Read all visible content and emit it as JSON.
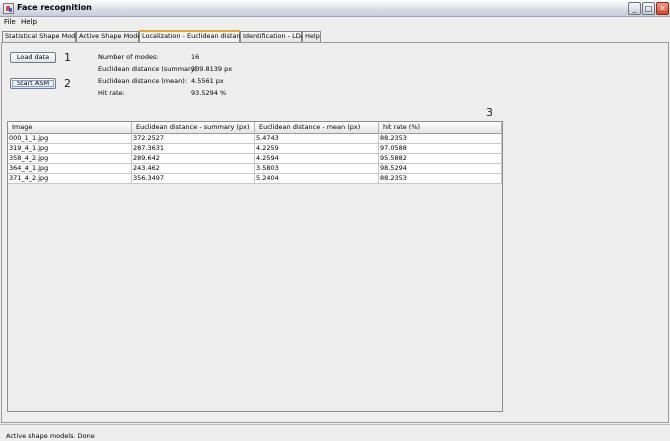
{
  "window": {
    "title": "Face recognition",
    "minimize_glyph": "_",
    "maximize_glyph": "□",
    "close_glyph": "✕"
  },
  "menu": {
    "items": [
      {
        "label": "File"
      },
      {
        "label": "Help"
      }
    ]
  },
  "tabs": [
    {
      "label": "Statistical Shape Model",
      "active": false
    },
    {
      "label": "Active Shape Model",
      "active": false
    },
    {
      "label": "Localization - Euclidean distance",
      "active": true
    },
    {
      "label": "Identification - LDA",
      "active": false
    },
    {
      "label": "Help",
      "active": false
    }
  ],
  "controls": {
    "load_data_label": "Load data",
    "start_asm_label": "Start ASM",
    "marker_1": "1",
    "marker_2": "2",
    "marker_3": "3"
  },
  "stats": [
    {
      "label": "Number of modes:",
      "value": "16"
    },
    {
      "label": "Euclidean distance (summary):",
      "value": "309.8139 px"
    },
    {
      "label": "Euclidean distance (mean):",
      "value": "4.5561 px"
    },
    {
      "label": "Hit rate:",
      "value": "93.5294 %"
    }
  ],
  "table": {
    "columns": [
      "Image",
      "Euclidean distance - summary (px)",
      "Euclidean distance - mean (px)",
      "hit rate (%)"
    ],
    "rows": [
      [
        "000_1_1.jpg",
        "372.2527",
        "5.4743",
        "88.2353"
      ],
      [
        "319_4_1.jpg",
        "287.3631",
        "4.2259",
        "97.0588"
      ],
      [
        "358_4_2.jpg",
        "289.642",
        "4.2594",
        "95.5882"
      ],
      [
        "364_4_1.jpg",
        "243.462",
        "3.5803",
        "98.5294"
      ],
      [
        "371_4_2.jpg",
        "356.3497",
        "5.2404",
        "88.2353"
      ]
    ]
  },
  "status": {
    "text": "Active shape models. Done"
  }
}
